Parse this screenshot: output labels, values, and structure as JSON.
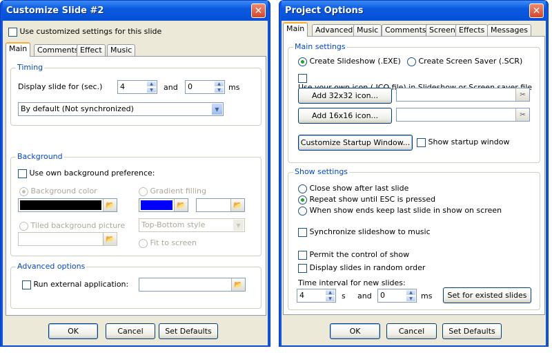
{
  "left": {
    "title": "Customize Slide #2",
    "use_custom_label": "Use customized settings for this slide",
    "tabs": [
      {
        "label": "Main"
      },
      {
        "label": "Comments"
      },
      {
        "label": "Effect"
      },
      {
        "label": "Music"
      }
    ],
    "timing": {
      "group_label": "Timing",
      "display_label": "Display slide for (sec.)",
      "value1": "4",
      "and_label": "and",
      "value2": "0",
      "unit": "ms",
      "sync_value": "By default (Not synchronized)"
    },
    "background": {
      "group_label": "Background",
      "own_pref_label": "Use own background preference:",
      "bg_color_label": "Background color",
      "bg_color": "#000000",
      "gradient_label": "Gradient filling",
      "gradient_color": "#0000ff",
      "tiled_label": "Tiled background picture",
      "style_value": "Top-Bottom style",
      "fit_label": "Fit to screen"
    },
    "advanced": {
      "group_label": "Advanced options",
      "run_ext_label": "Run external application:"
    },
    "buttons": {
      "ok": "OK",
      "cancel": "Cancel",
      "defaults": "Set Defaults"
    }
  },
  "right": {
    "title": "Project Options",
    "tabs": [
      {
        "label": "Main"
      },
      {
        "label": "Advanced"
      },
      {
        "label": "Music"
      },
      {
        "label": "Comments"
      },
      {
        "label": "Screen"
      },
      {
        "label": "Effects"
      },
      {
        "label": "Messages"
      }
    ],
    "main_settings": {
      "group_label": "Main settings",
      "create_slideshow": "Create Slideshow (.EXE)",
      "create_saver": "Create Screen Saver (.SCR)",
      "own_icon_label": "Use your own icon (.ICO file) in Slideshow or Screen saver file",
      "add32": "Add 32x32 icon...",
      "add16": "Add 16x16 icon...",
      "customize_startup": "Customize Startup Window...",
      "show_startup": "Show startup window"
    },
    "show_settings": {
      "group_label": "Show settings",
      "close_show": "Close show after last slide",
      "repeat_show": "Repeat show until ESC is pressed",
      "keep_last": "When show ends keep last slide in show on screen",
      "sync_music": "Synchronize slideshow to music",
      "permit_control": "Permit the control of show",
      "random_order": "Display slides in random order",
      "interval_label": "Time interval for new slides:",
      "interval_s": "4",
      "s_label": "s",
      "and_label": "and",
      "interval_ms": "0",
      "ms_label": "ms",
      "set_existed": "Set for existed slides"
    },
    "buttons": {
      "ok": "OK",
      "cancel": "Cancel",
      "defaults": "Set Defaults"
    }
  },
  "colors": {
    "title_bar": "#0b54e4",
    "group_label": "#0046d5",
    "dialog_bg": "#ece9d8"
  }
}
